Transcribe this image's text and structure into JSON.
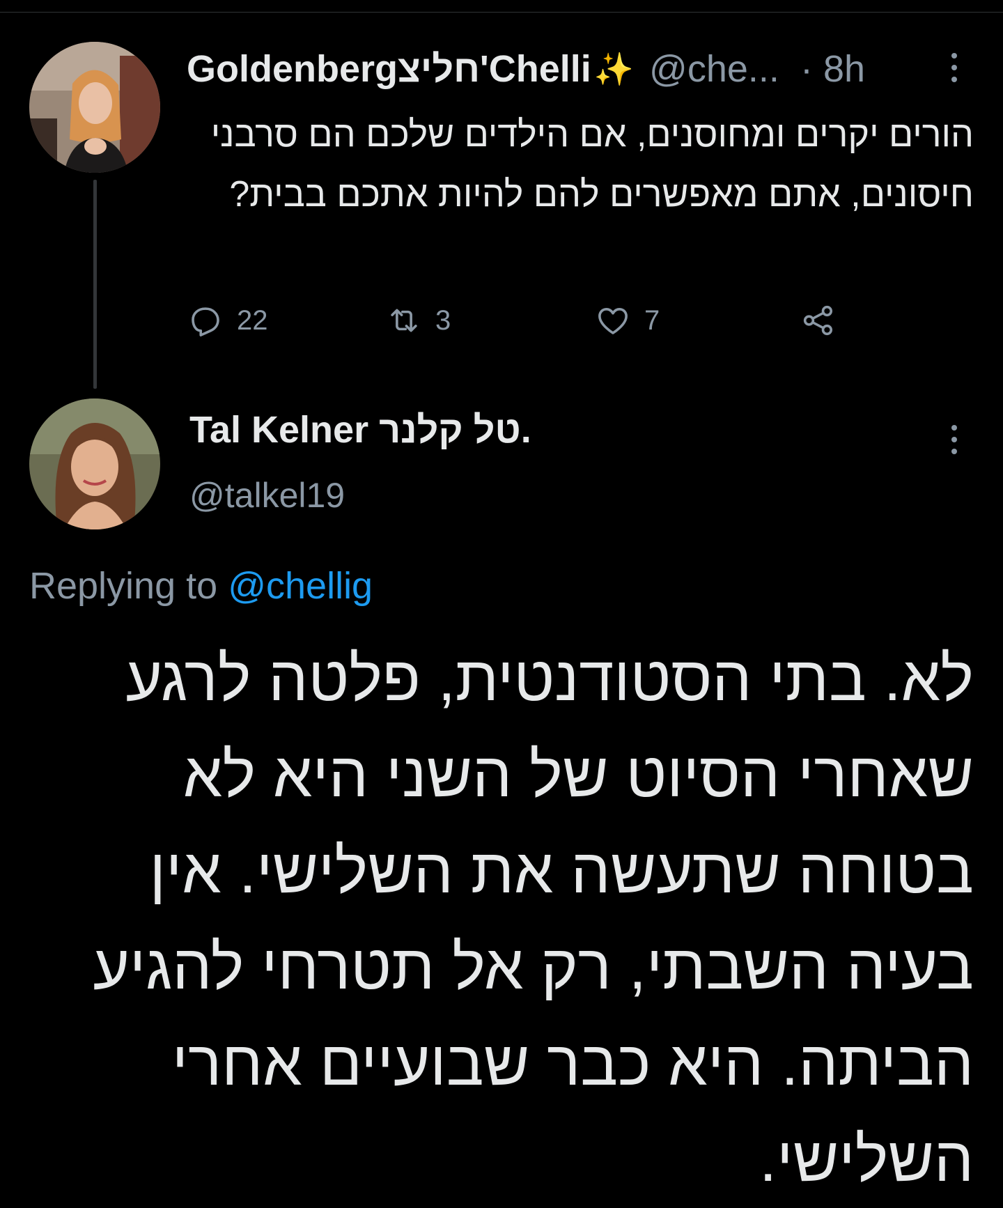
{
  "tweet": {
    "author_name": "Goldenbergחליצ'Chelli",
    "author_handle": "@che...",
    "separator": "·",
    "time": "8h",
    "emoji_icon": "sparkles-icon",
    "text": "הורים יקרים ומחוסנים, אם הילדים שלכם הם סרבני חיסונים, אתם מאפשרים להם להיות אתכם בבית?",
    "stats": {
      "replies": "22",
      "retweets": "3",
      "likes": "7"
    }
  },
  "reply": {
    "author_name": "Tal Kelner טל קלנר.",
    "author_handle": "@talkel19",
    "replying_prefix": "Replying to",
    "replying_mention": "@chellig",
    "text": "לא. בתי הסטודנטית, פלטה לרגע שאחרי הסיוט של השני היא לא בטוחה שתעשה את השלישי. אין בעיה השבתי, רק אל תטרחי להגיע הביתה. היא כבר שבועיים אחרי השלישי."
  },
  "colors": {
    "background": "#000000",
    "text_primary": "#e7e9ea",
    "text_secondary": "#8b98a5",
    "link": "#1d9bf0",
    "thread_line": "#333639"
  }
}
